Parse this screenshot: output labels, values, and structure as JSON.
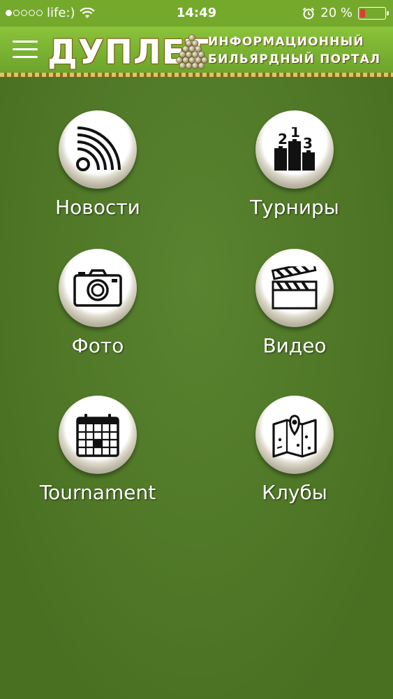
{
  "status_bar": {
    "carrier": "life:)",
    "time": "14:49",
    "battery": "20 %",
    "battery_level": 0.2,
    "battery_color": "#e23b2e"
  },
  "header": {
    "logo": "ДУПЛЕТ",
    "tagline_line1": "ИНФОРМАЦИОННЫЙ",
    "tagline_line2": "БИЛЬЯРДНЫЙ ПОРТАЛ",
    "menu_icon": "hamburger-icon"
  },
  "tiles": [
    {
      "label": "Новости",
      "icon": "rss-icon"
    },
    {
      "label": "Турниры",
      "icon": "podium-icon"
    },
    {
      "label": "Фото",
      "icon": "camera-icon"
    },
    {
      "label": "Видео",
      "icon": "clapperboard-icon"
    },
    {
      "label": "Tournament",
      "icon": "calendar-icon"
    },
    {
      "label": "Клубы",
      "icon": "map-icon"
    }
  ],
  "colors": {
    "background": "#517d25",
    "header": "#75a92c"
  }
}
